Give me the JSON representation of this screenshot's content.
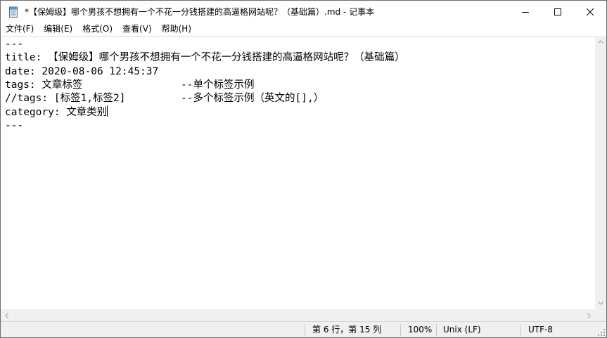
{
  "window": {
    "title": "*【保姆级】哪个男孩不想拥有一个不花一分钱搭建的高逼格网站呢？（基础篇）.md - 记事本"
  },
  "menu": [
    {
      "label": "文件(F)"
    },
    {
      "label": "编辑(E)"
    },
    {
      "label": "格式(O)"
    },
    {
      "label": "查看(V)"
    },
    {
      "label": "帮助(H)"
    }
  ],
  "editor": {
    "lines": [
      "---",
      "title: 【保姆级】哪个男孩不想拥有一个不花一分钱搭建的高逼格网站呢？（基础篇）",
      "date: 2020-08-06 12:45:37",
      "tags: 文章标签                --单个标签示例",
      "//tags: [标签1,标签2]         --多个标签示例（英文的[],）",
      "category: 文章类别",
      "---"
    ]
  },
  "status": {
    "position": "第 6 行，第 15 列",
    "zoom": "100%",
    "line_ending": "Unix (LF)",
    "encoding": "UTF-8"
  },
  "icons": {
    "app": "notepad-icon",
    "minimize": "minimize-icon",
    "maximize": "maximize-icon",
    "close": "close-icon"
  }
}
